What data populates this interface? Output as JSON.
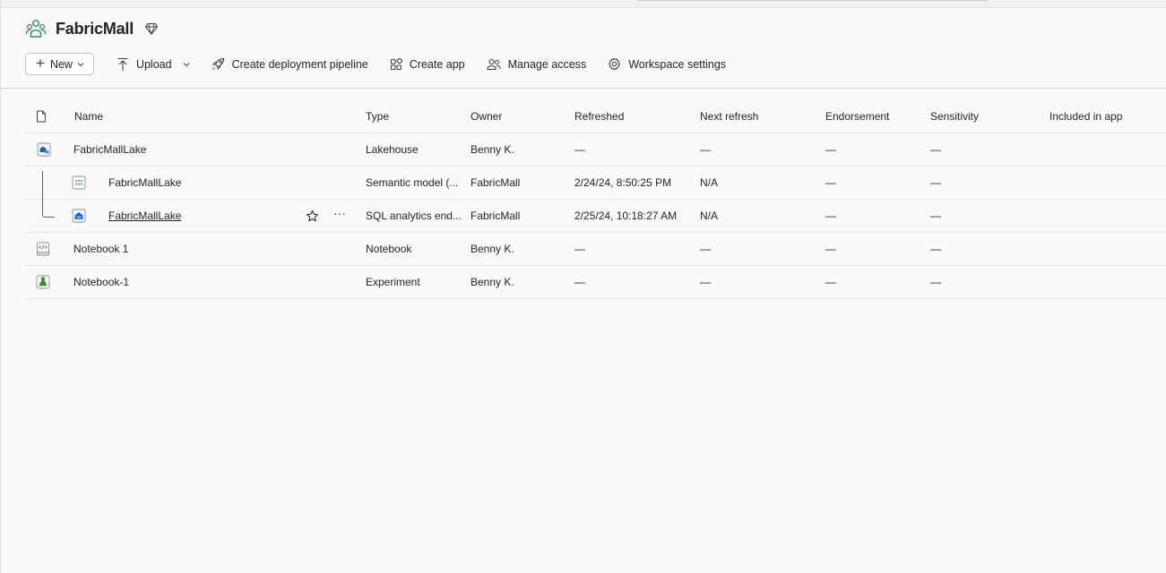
{
  "workspace": {
    "title": "FabricMall",
    "icon": "workspace-people-icon",
    "premium_icon": "diamond-icon"
  },
  "toolbar": {
    "new_label": "New",
    "upload_label": "Upload",
    "pipeline_label": "Create deployment pipeline",
    "create_app_label": "Create app",
    "manage_access_label": "Manage access",
    "settings_label": "Workspace settings"
  },
  "table": {
    "headers": {
      "name": "Name",
      "type": "Type",
      "owner": "Owner",
      "refreshed": "Refreshed",
      "next_refresh": "Next refresh",
      "endorsement": "Endorsement",
      "sensitivity": "Sensitivity",
      "included_in_app": "Included in app"
    },
    "rows": [
      {
        "name": "FabricMallLake",
        "type": "Lakehouse",
        "owner": "Benny K.",
        "refreshed": "—",
        "next_refresh": "—",
        "endorsement": "—",
        "sensitivity": "—",
        "icon": "lakehouse-icon"
      },
      {
        "name": "FabricMallLake",
        "type": "Semantic model (...",
        "owner": "FabricMall",
        "refreshed": "2/24/24, 8:50:25 PM",
        "next_refresh": "N/A",
        "endorsement": "—",
        "sensitivity": "—",
        "icon": "semantic-model-icon"
      },
      {
        "name": "FabricMallLake",
        "type": "SQL analytics end...",
        "owner": "FabricMall",
        "refreshed": "2/25/24, 10:18:27 AM",
        "next_refresh": "N/A",
        "endorsement": "—",
        "sensitivity": "—",
        "icon": "sql-endpoint-icon",
        "more_label": "···"
      },
      {
        "name": "Notebook 1",
        "type": "Notebook",
        "owner": "Benny K.",
        "refreshed": "—",
        "next_refresh": "—",
        "endorsement": "—",
        "sensitivity": "—",
        "icon": "notebook-icon"
      },
      {
        "name": "Notebook-1",
        "type": "Experiment",
        "owner": "Benny K.",
        "refreshed": "—",
        "next_refresh": "—",
        "endorsement": "—",
        "sensitivity": "—",
        "icon": "experiment-icon"
      }
    ]
  },
  "colors": {
    "accent_green": "#2e8b57",
    "lakehouse_blue": "#1f5fbf",
    "experiment_green": "#3a8f3a"
  }
}
